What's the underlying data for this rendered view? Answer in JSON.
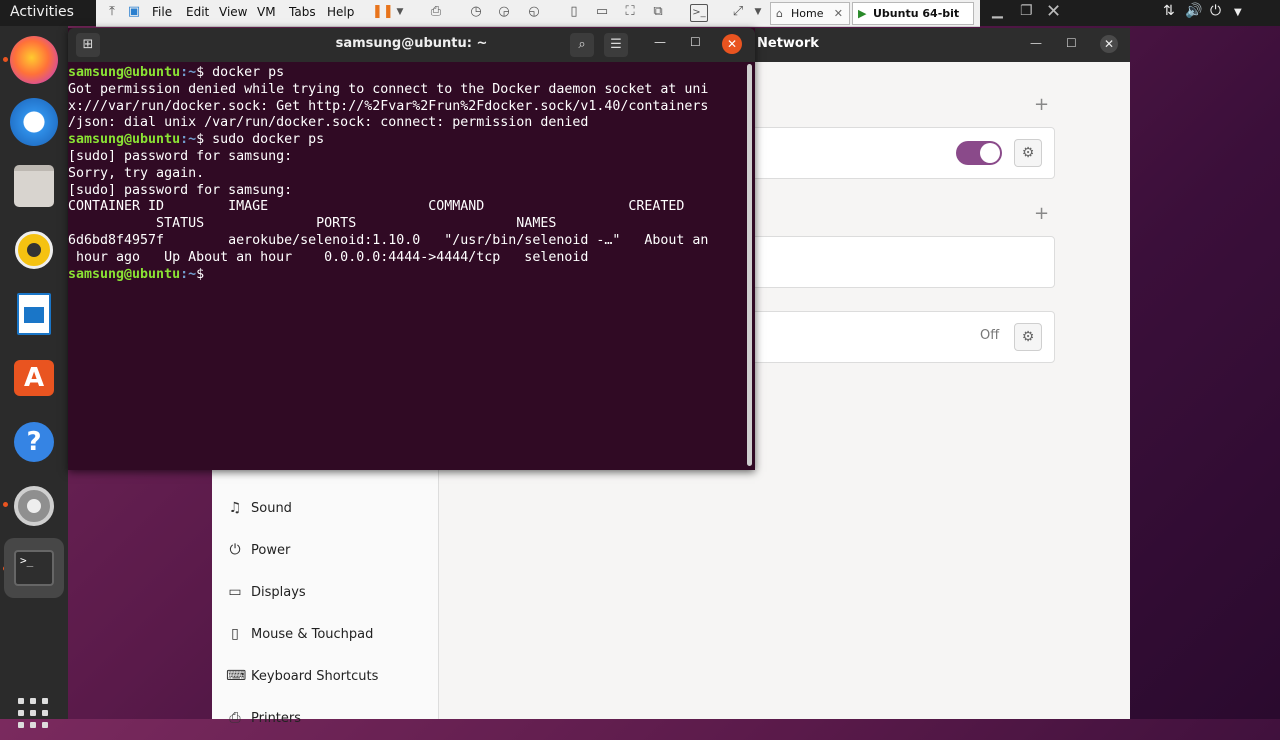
{
  "topbar": {
    "activities": "Activities",
    "vm_menus": [
      "File",
      "Edit",
      "View",
      "VM",
      "Tabs",
      "Help"
    ],
    "tabs": [
      {
        "label": "Home"
      },
      {
        "label": "Ubuntu 64-bit"
      }
    ]
  },
  "terminal": {
    "title": "samsung@ubuntu: ~",
    "prompt_user": "samsung@ubuntu",
    "prompt_path": ":~",
    "lines": [
      {
        "type": "prompt",
        "cmd": "$ docker ps"
      },
      {
        "type": "out",
        "text": "Got permission denied while trying to connect to the Docker daemon socket at uni"
      },
      {
        "type": "out",
        "text": "x:///var/run/docker.sock: Get http://%2Fvar%2Frun%2Fdocker.sock/v1.40/containers"
      },
      {
        "type": "out",
        "text": "/json: dial unix /var/run/docker.sock: connect: permission denied"
      },
      {
        "type": "prompt",
        "cmd": "$ sudo docker ps"
      },
      {
        "type": "out",
        "text": "[sudo] password for samsung:"
      },
      {
        "type": "out",
        "text": "Sorry, try again."
      },
      {
        "type": "out",
        "text": "[sudo] password for samsung:"
      },
      {
        "type": "out",
        "text": "CONTAINER ID        IMAGE                    COMMAND                  CREATED"
      },
      {
        "type": "out",
        "text": "           STATUS              PORTS                    NAMES"
      },
      {
        "type": "out",
        "text": "6d6bd8f4957f        aerokube/selenoid:1.10.0   \"/usr/bin/selenoid -…\"   About an"
      },
      {
        "type": "out",
        "text": " hour ago   Up About an hour    0.0.0.0:4444->4444/tcp   selenoid"
      },
      {
        "type": "prompt",
        "cmd": "$ "
      }
    ]
  },
  "settings": {
    "title": "Network",
    "off_label": "Off",
    "sidebar": [
      {
        "label": "Sound",
        "icon": "music-note-icon"
      },
      {
        "label": "Power",
        "icon": "power-icon"
      },
      {
        "label": "Displays",
        "icon": "display-icon"
      },
      {
        "label": "Mouse & Touchpad",
        "icon": "mouse-icon"
      },
      {
        "label": "Keyboard Shortcuts",
        "icon": "keyboard-icon"
      },
      {
        "label": "Printers",
        "icon": "printer-icon"
      }
    ]
  },
  "colors": {
    "terminal_bg": "#300a24",
    "prompt_user": "#8ae234",
    "prompt_path": "#729fcf",
    "accent": "#e95420",
    "toggle_on": "#8a4a8a"
  }
}
